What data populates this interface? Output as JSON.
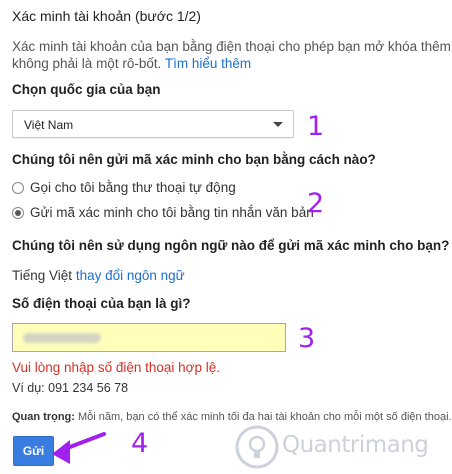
{
  "header": {
    "title": "Xác minh tài khoản (bước 1/2)"
  },
  "intro": {
    "line1": "Xác minh tài khoản của bạn bằng điện thoại cho phép bạn mở khóa thêm các",
    "line2_prefix": "không phải là một rô-bốt.",
    "learn_more": "Tìm hiểu thêm"
  },
  "country": {
    "label": "Chọn quốc gia của bạn",
    "selected": "Việt Nam"
  },
  "method": {
    "question": "Chúng tôi nên gửi mã xác minh cho bạn bằng cách nào?",
    "options": [
      {
        "label": "Gọi cho tôi bằng thư thoại tự động",
        "checked": false
      },
      {
        "label": "Gửi mã xác minh cho tôi bằng tin nhắn văn bản",
        "checked": true
      }
    ]
  },
  "language": {
    "question": "Chúng tôi nên sử dụng ngôn ngữ nào để gửi mã xác minh cho bạn?",
    "current": "Tiếng Việt",
    "change_link": "thay đổi ngôn ngữ"
  },
  "phone": {
    "question": "Số điện thoại của bạn là gì?",
    "error": "Vui lòng nhập số điện thoại hợp lệ.",
    "example": "Ví dụ: 091 234 56 78"
  },
  "note": {
    "bold": "Quan trọng:",
    "text": " Mỗi năm, bạn có thể xác minh tối đa hai tài khoản cho mỗi một số điện thoại."
  },
  "submit": {
    "label": "Gửi"
  },
  "annotations": {
    "n1": "1",
    "n2": "2",
    "n3": "3",
    "n4": "4",
    "color": "#a020f0"
  },
  "watermark": {
    "text": "Quantrimang"
  }
}
